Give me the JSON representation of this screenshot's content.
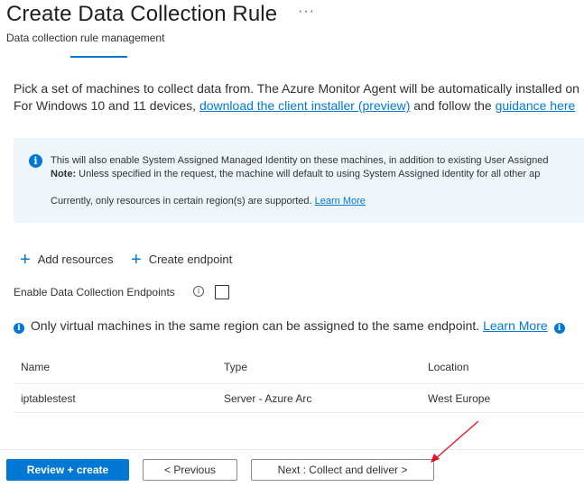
{
  "header": {
    "title": "Create Data Collection Rule",
    "more": "···",
    "subtitle": "Data collection rule management"
  },
  "description": {
    "line1": "Pick a set of machines to collect data from. The Azure Monitor Agent will be automatically installed on",
    "line2_prefix": "For Windows 10 and 11 devices, ",
    "line2_link1": "download the client installer (preview)",
    "line2_middle": " and follow the ",
    "line2_link2": "guidance here"
  },
  "info_box": {
    "icon": "info-icon",
    "line1": "This will also enable System Assigned Managed Identity on these machines, in addition to existing User Assigned",
    "note_label": "Note:",
    "line2": " Unless specified in the request, the machine will default to using System Assigned Identity for all other ap",
    "line3": "Currently, only resources in certain region(s) are supported. ",
    "line3_link": "Learn More"
  },
  "commands": {
    "add_resources": "Add resources",
    "create_endpoint": "Create endpoint"
  },
  "endpoint_toggle": {
    "label": "Enable Data Collection Endpoints",
    "checked": false
  },
  "endpoint_note": {
    "text": "Only virtual machines in the same region can be assigned to the same endpoint. ",
    "link": "Learn More"
  },
  "table": {
    "columns": [
      "Name",
      "Type",
      "Location"
    ],
    "rows": [
      {
        "name": "iptablestest",
        "type": "Server - Azure Arc",
        "location": "West Europe"
      }
    ]
  },
  "footer": {
    "review_create": "Review + create",
    "previous": "< Previous",
    "next": "Next : Collect and deliver >"
  },
  "colors": {
    "accent": "#0078d4",
    "annotation_arrow": "#e81123"
  }
}
